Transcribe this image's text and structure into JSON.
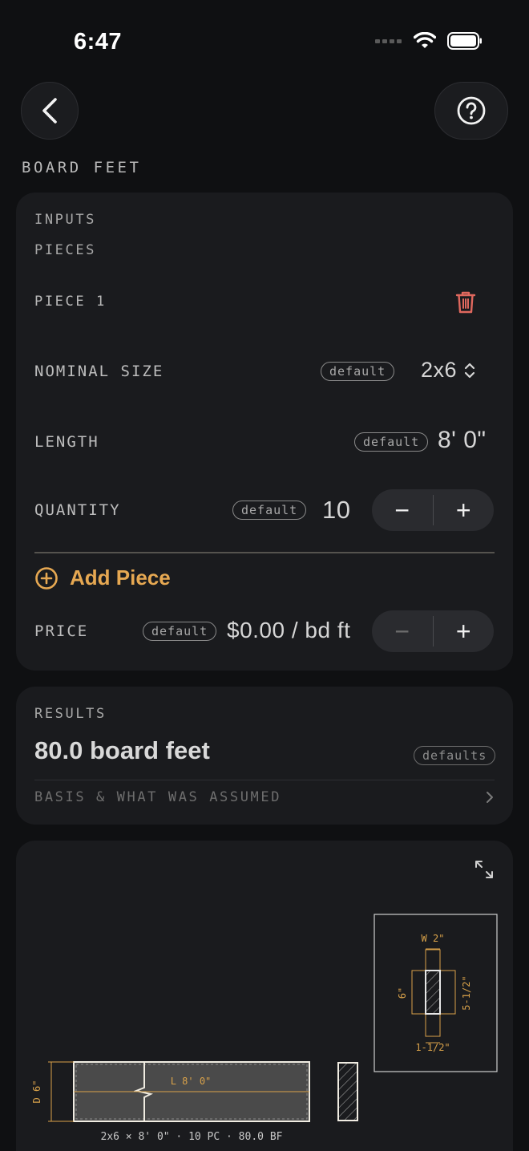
{
  "status": {
    "time": "6:47"
  },
  "header": {
    "title": "BOARD FEET"
  },
  "inputs": {
    "section_label": "INPUTS",
    "pieces_label": "PIECES",
    "piece_title": "PIECE 1",
    "nominal_size": {
      "label": "NOMINAL SIZE",
      "badge": "default",
      "value": "2x6"
    },
    "length": {
      "label": "LENGTH",
      "badge": "default",
      "value": "8' 0\""
    },
    "quantity": {
      "label": "QUANTITY",
      "badge": "default",
      "value": "10",
      "minus": "−",
      "plus": "+"
    },
    "add_piece_label": "Add Piece",
    "price": {
      "label": "PRICE",
      "badge": "default",
      "value": "$0.00 / bd ft",
      "minus": "−",
      "plus": "+"
    }
  },
  "results": {
    "section_label": "RESULTS",
    "value": "80.0 board feet",
    "badge": "defaults",
    "basis_label": "BASIS & WHAT WAS ASSUMED"
  },
  "diagram": {
    "length_label": "L 8' 0\"",
    "depth_label": "D 6\"",
    "caption": "2x6 × 8' 0\" · 10 PC · 80.0 BF",
    "section_width": "W 2\"",
    "section_nominal_height": "6\"",
    "section_actual_height": "5-1/2\"",
    "section_actual_width": "1-1/2\"",
    "accent_color": "#d9a24a"
  },
  "colors": {
    "accent": "#e6a852",
    "danger": "#e0685e",
    "card": "#1a1b1e",
    "background": "#0f1012"
  }
}
